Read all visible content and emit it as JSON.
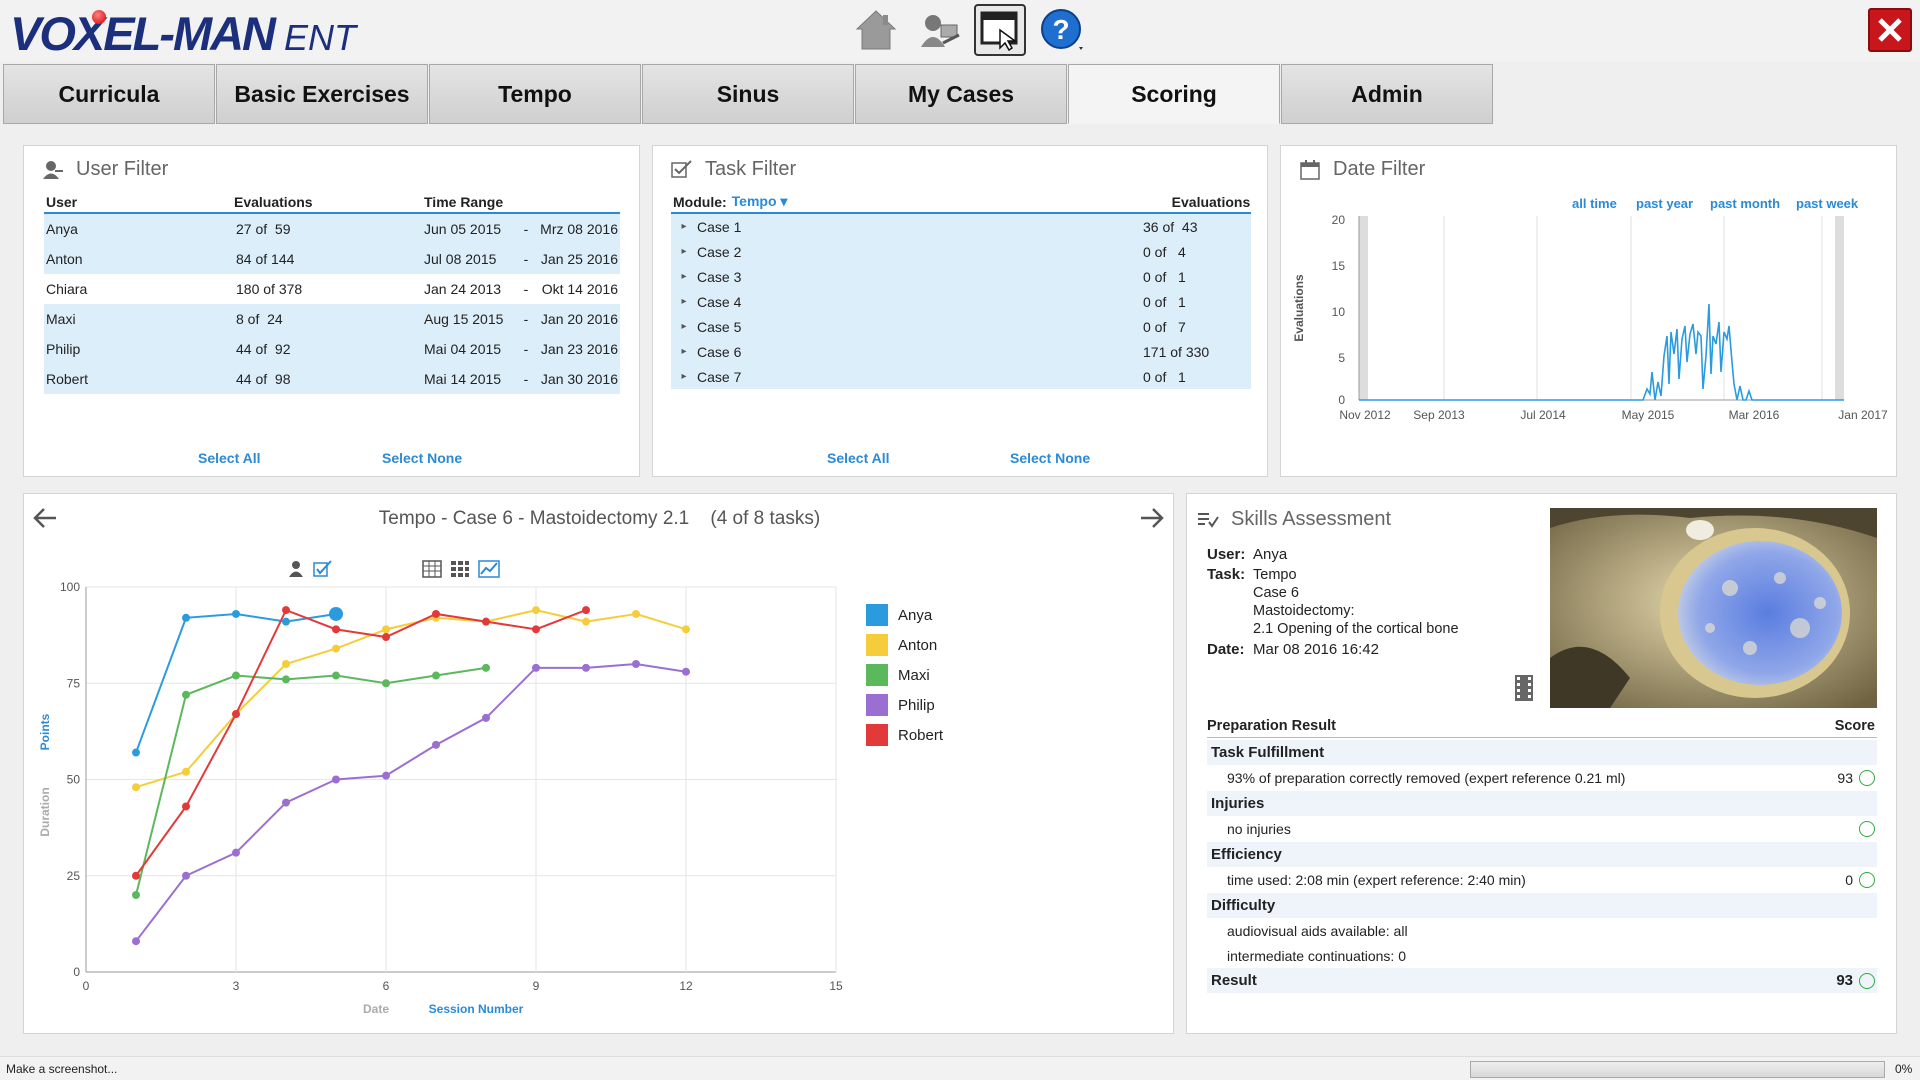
{
  "app": {
    "brand": "VOXEL-MAN",
    "sub": "ENT"
  },
  "toolbar": {
    "icons": [
      "home-icon",
      "users-icon",
      "screenshot-icon",
      "help-icon"
    ]
  },
  "tabs": [
    {
      "label": "Curricula"
    },
    {
      "label": "Basic Exercises"
    },
    {
      "label": "Tempo"
    },
    {
      "label": "Sinus"
    },
    {
      "label": "My Cases"
    },
    {
      "label": "Scoring",
      "active": true
    },
    {
      "label": "Admin"
    }
  ],
  "user_filter": {
    "title": "User Filter",
    "headers": {
      "user": "User",
      "evaluations": "Evaluations",
      "range": "Time Range"
    },
    "rows": [
      {
        "user": "Anya",
        "eval": "27 of  59",
        "from": "Jun 05 2015",
        "to": "Mrz 08 2016",
        "selected": true
      },
      {
        "user": "Anton",
        "eval": "84 of 144",
        "from": "Jul 08 2015",
        "to": "Jan 25 2016",
        "selected": true
      },
      {
        "user": "Chiara",
        "eval": "180 of 378",
        "from": "Jan 24 2013",
        "to": "Okt 14 2016",
        "selected": false
      },
      {
        "user": "Maxi",
        "eval": "8 of  24",
        "from": "Aug 15 2015",
        "to": "Jan 20 2016",
        "selected": true
      },
      {
        "user": "Philip",
        "eval": "44 of  92",
        "from": "Mai 04 2015",
        "to": "Jan 23 2016",
        "selected": true
      },
      {
        "user": "Robert",
        "eval": "44 of  98",
        "from": "Mai 14 2015",
        "to": "Jan 30 2016",
        "selected": true
      }
    ],
    "dash": "-",
    "select_all": "Select All",
    "select_none": "Select None"
  },
  "task_filter": {
    "title": "Task Filter",
    "module_label": "Module:",
    "module_value": "Tempo",
    "eval_header": "Evaluations",
    "rows": [
      {
        "task": "Case 1",
        "eval": "36 of  43"
      },
      {
        "task": "Case 2",
        "eval": "0 of   4"
      },
      {
        "task": "Case 3",
        "eval": "0 of   1"
      },
      {
        "task": "Case 4",
        "eval": "0 of   1"
      },
      {
        "task": "Case 5",
        "eval": "0 of   7"
      },
      {
        "task": "Case 6",
        "eval": "171 of 330"
      },
      {
        "task": "Case 7",
        "eval": "0 of   1"
      }
    ],
    "select_all": "Select All",
    "select_none": "Select None"
  },
  "date_filter": {
    "title": "Date Filter",
    "quick": [
      "all time",
      "past year",
      "past month",
      "past week"
    ],
    "ylabel": "Evaluations",
    "yticks": [
      "20",
      "15",
      "10",
      "5",
      "0"
    ],
    "xticks": [
      "Nov 2012",
      "Sep 2013",
      "Jul 2014",
      "May 2015",
      "Mar 2016",
      "Jan 2017"
    ]
  },
  "progress_chart": {
    "title": "Tempo - Case 6 - Mastoidectomy 2.1",
    "task_count": "(4 of 8 tasks)",
    "y_label_points": "Points",
    "y_label_duration": "Duration",
    "x_label_date": "Date",
    "x_label_session": "Session Number",
    "yticks": [
      "100",
      "75",
      "50",
      "25",
      "0"
    ],
    "xticks": [
      "0",
      "3",
      "6",
      "9",
      "12",
      "15"
    ]
  },
  "chart_data": {
    "type": "line",
    "xlabel": "Session Number",
    "ylabel": "Points",
    "xlim": [
      0,
      15
    ],
    "ylim": [
      0,
      100
    ],
    "series": [
      {
        "name": "Anya",
        "color": "#2b9be0",
        "x": [
          1,
          2,
          3,
          4,
          5
        ],
        "values": [
          57,
          92,
          93,
          91,
          93
        ]
      },
      {
        "name": "Anton",
        "color": "#f5cd3b",
        "x": [
          1,
          2,
          3,
          4,
          5,
          6,
          7,
          8,
          9,
          10,
          11,
          12
        ],
        "values": [
          48,
          52,
          67,
          80,
          84,
          89,
          92,
          91,
          94,
          91,
          93,
          89
        ]
      },
      {
        "name": "Maxi",
        "color": "#5cb85c",
        "x": [
          1,
          2,
          3,
          4,
          5,
          6,
          7,
          8
        ],
        "values": [
          20,
          72,
          77,
          76,
          77,
          75,
          77,
          79
        ]
      },
      {
        "name": "Philip",
        "color": "#9b6fd2",
        "x": [
          1,
          2,
          3,
          4,
          5,
          6,
          7,
          8,
          9,
          10,
          11,
          12
        ],
        "values": [
          8,
          25,
          31,
          44,
          50,
          51,
          59,
          66,
          79,
          79,
          80,
          78
        ]
      },
      {
        "name": "Robert",
        "color": "#e23a3a",
        "x": [
          1,
          2,
          3,
          4,
          5,
          6,
          7,
          8,
          9,
          10
        ],
        "values": [
          25,
          43,
          67,
          94,
          89,
          87,
          93,
          91,
          89,
          94
        ]
      }
    ]
  },
  "skills": {
    "title": "Skills Assessment",
    "user_label": "User:",
    "user": "Anya",
    "task_label": "Task:",
    "task_lines": [
      "Tempo",
      "Case 6",
      "Mastoidectomy:",
      "2.1 Opening of the cortical bone"
    ],
    "date_label": "Date:",
    "date": "Mar 08 2016 16:42",
    "result_header": "Preparation Result",
    "score_header": "Score",
    "task_fulfillment": "Task Fulfillment",
    "tf_detail": "93% of preparation correctly removed (expert reference 0.21 ml)",
    "tf_score": "93",
    "injuries": "Injuries",
    "inj_detail": "no injuries",
    "efficiency": "Efficiency",
    "eff_detail": "time used: 2:08 min (expert reference: 2:40 min)",
    "eff_score": "0",
    "difficulty": "Difficulty",
    "diff_detail1": "audiovisual aids available: all",
    "diff_detail2": "intermediate continuations: 0",
    "result": "Result",
    "result_score": "93"
  },
  "status": {
    "text": "Make a screenshot...",
    "progress_pct": "0%",
    "progress": 0
  }
}
